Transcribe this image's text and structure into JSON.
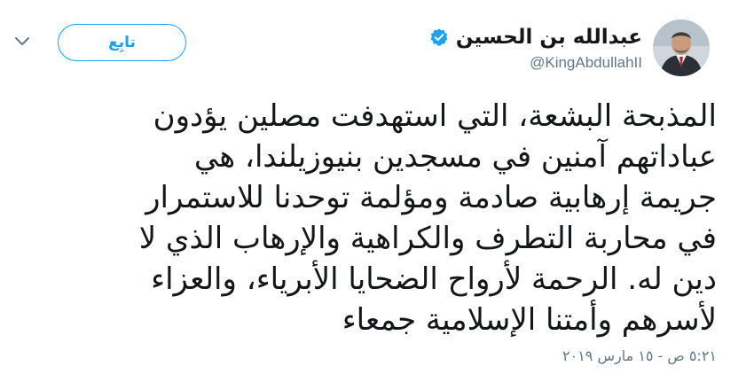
{
  "tweet": {
    "author": {
      "display_name": "عبدالله بن الحسين",
      "handle": "@KingAbdullahII",
      "verified": true,
      "avatar_icon": "profile-photo"
    },
    "follow_label": "تابِع",
    "menu_icon": "chevron-down-icon",
    "text_lines": [
      "المذبحة البشعة، التي استهدفت مصلين يؤدون",
      "عباداتهم آمنين في مسجدين بنيوزيلندا، هي",
      "جريمة إرهابية صادمة ومؤلمة توحدنا للاستمرار",
      "في محاربة التطرف والكراهية والإرهاب الذي لا",
      "دين له. الرحمة لأرواح الضحايا الأبرياء، والعزاء",
      "لأسرهم وأمتنا الإسلامية جمعاء"
    ],
    "timestamp": "٥:٢١ ص - ١٥ مارس ٢٠١٩"
  },
  "colors": {
    "accent": "#1da1f2",
    "text": "#14171a",
    "muted": "#657786",
    "background": "#ffffff"
  }
}
